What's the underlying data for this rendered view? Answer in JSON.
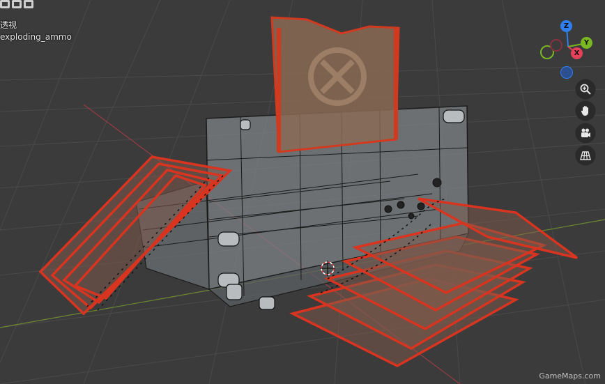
{
  "viewport": {
    "view_mode": "透视",
    "object_name": "exploding_ammo"
  },
  "gizmo": {
    "z_label": "Z",
    "y_label": "Y",
    "x_label": "X",
    "colors": {
      "z": "#2f7ff0",
      "y": "#7ab821",
      "x": "#e8405a",
      "neg_y": "#4a6b1f",
      "neg_x": "#8a3040",
      "neg_z": "#2c4f8f"
    }
  },
  "nav_buttons": [
    {
      "name": "zoom-icon"
    },
    {
      "name": "hand-icon"
    },
    {
      "name": "camera-icon"
    },
    {
      "name": "grid-icon"
    }
  ],
  "watermark": "GameMaps.com"
}
